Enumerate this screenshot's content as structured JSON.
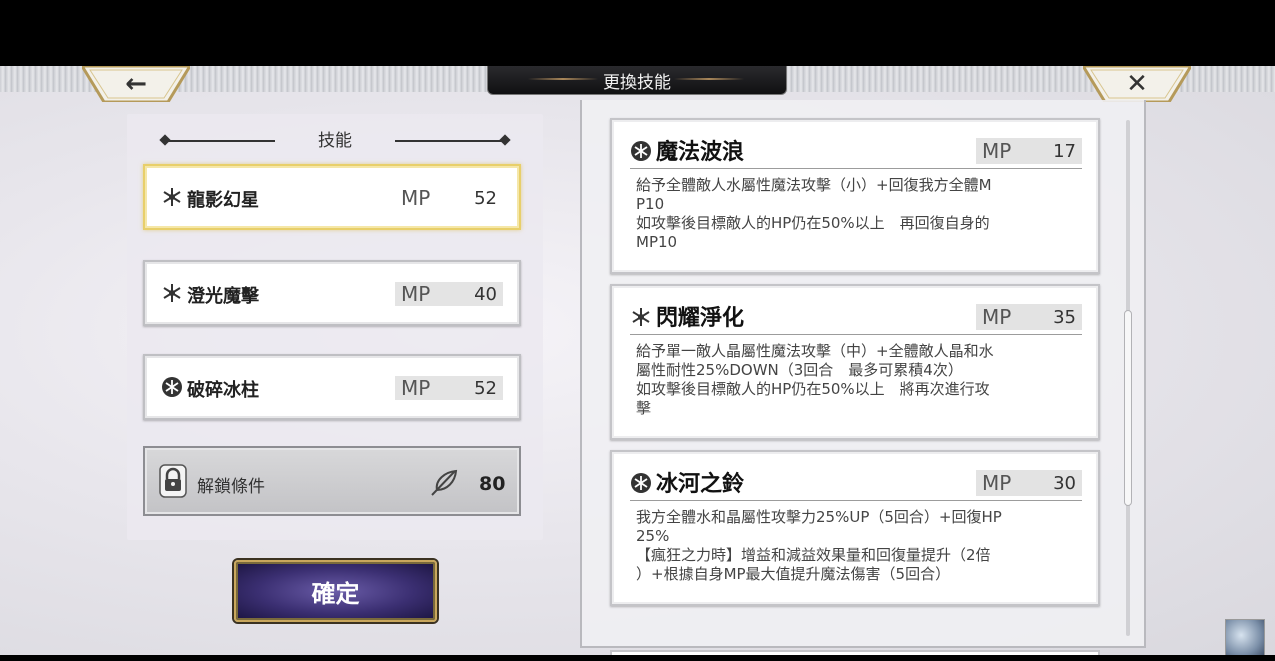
{
  "header": {
    "title": "更換技能",
    "back_icon": "←",
    "close_icon": "✕"
  },
  "left_panel": {
    "heading": "技能",
    "mp_label": "MP",
    "skills": [
      {
        "name": "龍影幻星",
        "mp": "52",
        "selected": true
      },
      {
        "name": "澄光魔擊",
        "mp": "40",
        "selected": false
      },
      {
        "name": "破碎冰柱",
        "mp": "52",
        "selected": false
      }
    ],
    "unlock": {
      "label": "解鎖條件",
      "value": "80",
      "icon": "feather-icon"
    }
  },
  "confirm_button": "確定",
  "detail_list": [
    {
      "name": "魔法波浪",
      "mp": "17",
      "desc": "給予全體敵人水屬性魔法攻擊（小）+回復我方全體M\nP10\n如攻擊後目標敵人的HP仍在50%以上　再回復自身的\nMP10"
    },
    {
      "name": "閃耀淨化",
      "mp": "35",
      "desc": "給予單一敵人晶屬性魔法攻擊（中）+全體敵人晶和水\n屬性耐性25%DOWN（3回合　最多可累積4次）\n如攻擊後目標敵人的HP仍在50%以上　將再次進行攻\n擊"
    },
    {
      "name": "冰河之鈴",
      "mp": "30",
      "desc": "我方全體水和晶屬性攻擊力25%UP（5回合）+回復HP\n25%\n【瘋狂之力時】增益和減益效果量和回復量提升（2倍\n）+根據自身MP最大值提升魔法傷害（5回合）"
    }
  ],
  "colors": {
    "selected_border": "#e8cf6a",
    "confirm_bg": "#3b2f72",
    "confirm_border": "#c9a75d"
  }
}
